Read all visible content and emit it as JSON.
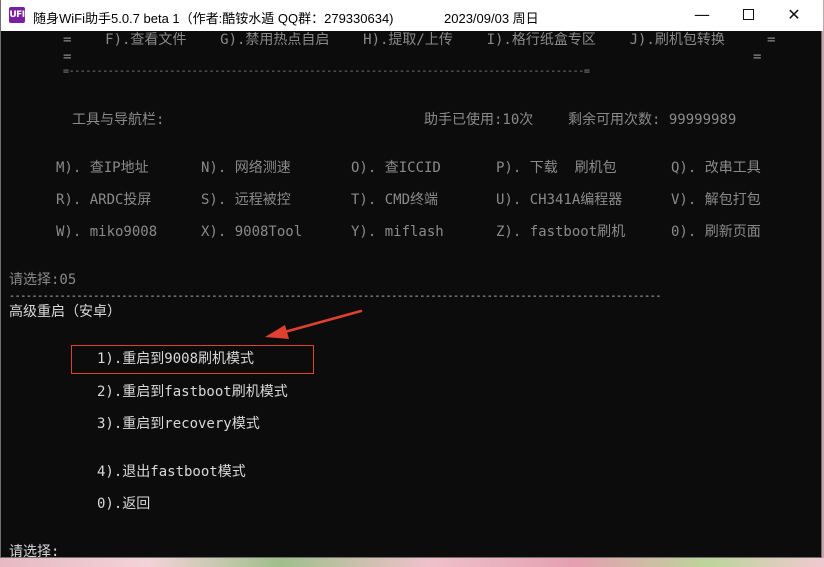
{
  "window": {
    "title": "随身WiFi助手5.0.7 beta 1（作者:酷铵水遁 QQ群：279330634)",
    "date": "2023/09/03 周日",
    "icon_text": "UFI",
    "controls": {
      "minimize": "—",
      "close": "✕"
    }
  },
  "console": {
    "top_menu": {
      "row": "=    F).查看文件    G).禁用热点自启    H).提取/上传    I).格行纸盒专区    J).刷机包转换     =",
      "left_eq": "=",
      "right_eq": "=",
      "divider": "=--------------------------------------------------------------------------------------------="
    },
    "toolbar": {
      "label": "工具与导航栏:",
      "used": "助手已使用:10次",
      "remaining": "剩余可用次数: 99999989"
    },
    "tools": [
      [
        "M). 查IP地址",
        "N). 网络测速",
        "O). 查ICCID",
        "P). 下载  刷机包",
        "Q). 改串工具"
      ],
      [
        "R). ARDC投屏",
        "S). 远程被控",
        "T). CMD终端",
        "U). CH341A编程器",
        "V). 解包打包"
      ],
      [
        "W). miko9008",
        "X). 9008Tool",
        "Y). miflash",
        "Z). fastboot刷机",
        "0). 刷新页面"
      ]
    ],
    "prompt1": "请选择:05",
    "separator": "--------------------------------------------------------------------------------------------------------------------",
    "section_title": "高级重启（安卓）",
    "options": [
      "1).重启到9008刷机模式",
      "2).重启到fastboot刷机模式",
      "3).重启到recovery模式",
      "4).退出fastboot模式",
      "0).返回"
    ],
    "prompt2": "请选择:",
    "annotation_color": "#e0402f"
  }
}
